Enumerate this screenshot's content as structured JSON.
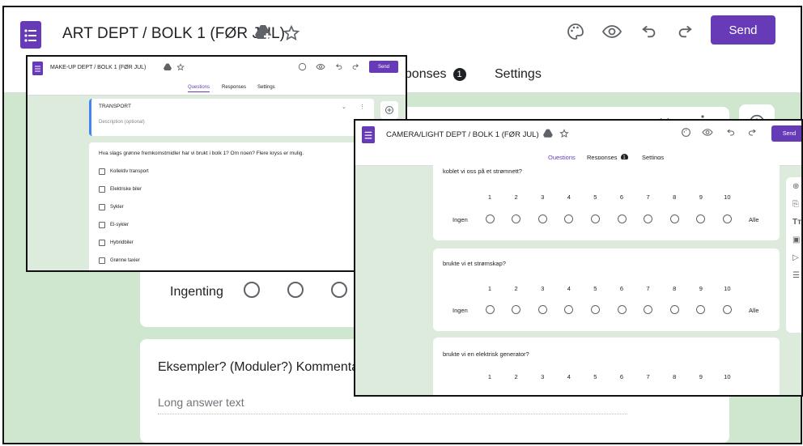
{
  "colors": {
    "brand": "#673ab7",
    "background": "#cfe6cf",
    "card": "#ffffff",
    "text": "#202124",
    "muted": "#70757a"
  },
  "art": {
    "title": "ART DEPT / BOLK 1 (FØR JUL)",
    "send_label": "Send",
    "tabs": {
      "responses": "esponses",
      "responses_badge": "1",
      "settings": "Settings"
    },
    "row_label": "Ingenting",
    "question_title": "Eksempler? (Moduler?) Kommentarer",
    "long_answer": "Long answer text"
  },
  "makeup": {
    "title": "MAKE-UP DEPT / BOLK 1 (FØR JUL)",
    "send_label": "Send",
    "tabs": {
      "questions": "Questions",
      "responses": "Responses",
      "settings": "Settings"
    },
    "section_title": "TRANSPORT",
    "section_description": "Description (optional)",
    "question": "Hva slags grønne fremkomstmidler har vi brukt i bolk 1? Om noen? Flere kryss er mulig.",
    "options": [
      "Kollektiv transport",
      "Elektriske biler",
      "Sykler",
      "El-sykler",
      "Hybridbiler",
      "Grønne taxier"
    ]
  },
  "camera": {
    "title": "CAMERA/LIGHT DEPT / BOLK 1 (FØR JUL)",
    "send_label": "Send",
    "tabs": {
      "questions": "Questions",
      "responses": "Responses",
      "responses_badge": "1",
      "settings": "Settings"
    },
    "scale_min_label": "Ingen",
    "scale_max_label": "Alle",
    "scale": [
      "1",
      "2",
      "3",
      "4",
      "5",
      "6",
      "7",
      "8",
      "9",
      "10"
    ],
    "questions": [
      "koblet vi oss på et strømnett?",
      "brukte vi et strømskap?",
      "brukte vi en elektrisk generator?"
    ]
  }
}
